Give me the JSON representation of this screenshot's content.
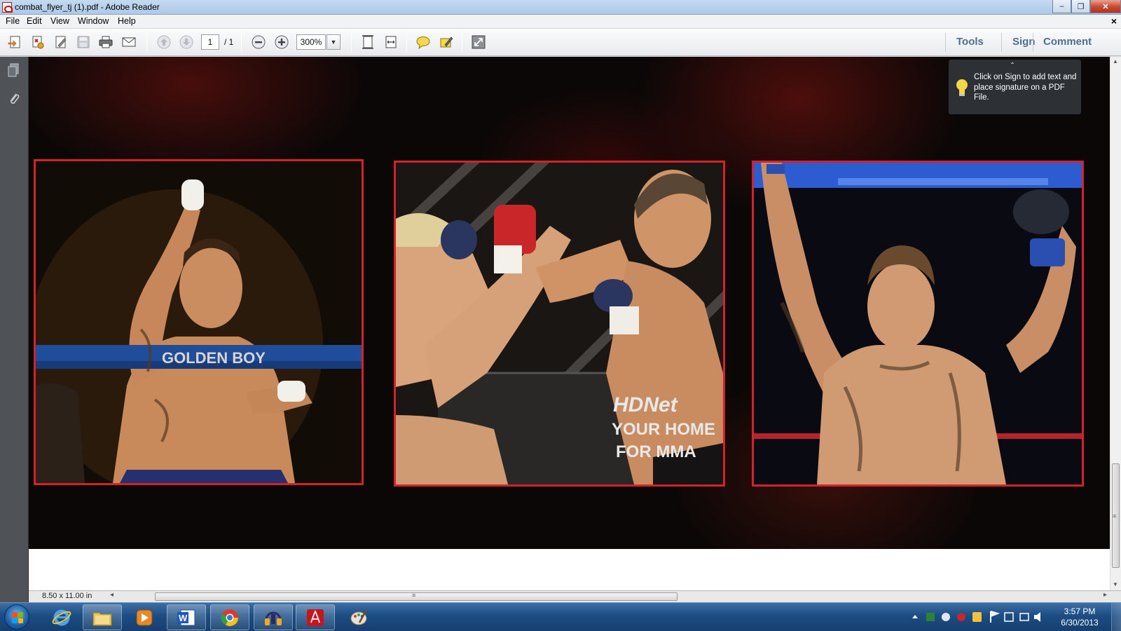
{
  "window": {
    "title": "combat_flyer_tj (1).pdf - Adobe Reader",
    "minimize": "–",
    "restore": "❐",
    "close": "✕"
  },
  "menu": {
    "items": [
      "File",
      "Edit",
      "View",
      "Window",
      "Help"
    ],
    "doc_close": "×"
  },
  "toolbar": {
    "page_current": "1",
    "page_total": "/ 1",
    "zoom": "300%",
    "zoom_dropdown": "▼",
    "tabs": [
      "Tools",
      "Sign",
      "Comment"
    ]
  },
  "icons": {
    "toolbar": [
      "create-icon",
      "combine-icon",
      "edit-icon",
      "save-icon",
      "print-icon",
      "email-icon",
      "prev-page-icon",
      "next-page-icon",
      "zoom-out-icon",
      "zoom-in-icon",
      "fit-page-icon",
      "fit-width-icon",
      "comment-icon",
      "highlight-icon",
      "fullscreen-icon"
    ],
    "nav": [
      "pages-icon",
      "attachment-icon"
    ]
  },
  "tooltip": {
    "caret": "ˆ",
    "text": "Click on Sign to add text and place signature on a PDF File."
  },
  "document": {
    "photo_overlays": {
      "ring_banner": "GOLDEN BOY",
      "cage_sign_1": "HDNet",
      "cage_sign_2": "YOUR HOME",
      "cage_sign_3": "FOR MMA"
    }
  },
  "status": {
    "page_size": "8.50 x 11.00 in",
    "left_arrow": "◂",
    "right_arrow": "▸",
    "grip": "≡"
  },
  "taskbar": {
    "apps": [
      "internet-explorer",
      "file-explorer",
      "media-player",
      "microsoft-word",
      "google-chrome",
      "audio-app",
      "adobe-reader",
      "paint"
    ],
    "time": "3:57 PM",
    "date": "6/30/2013"
  },
  "colors": {
    "photo_border": "#d3222c",
    "tab_text": "#4e6f93",
    "page_background": "#0b0707"
  }
}
